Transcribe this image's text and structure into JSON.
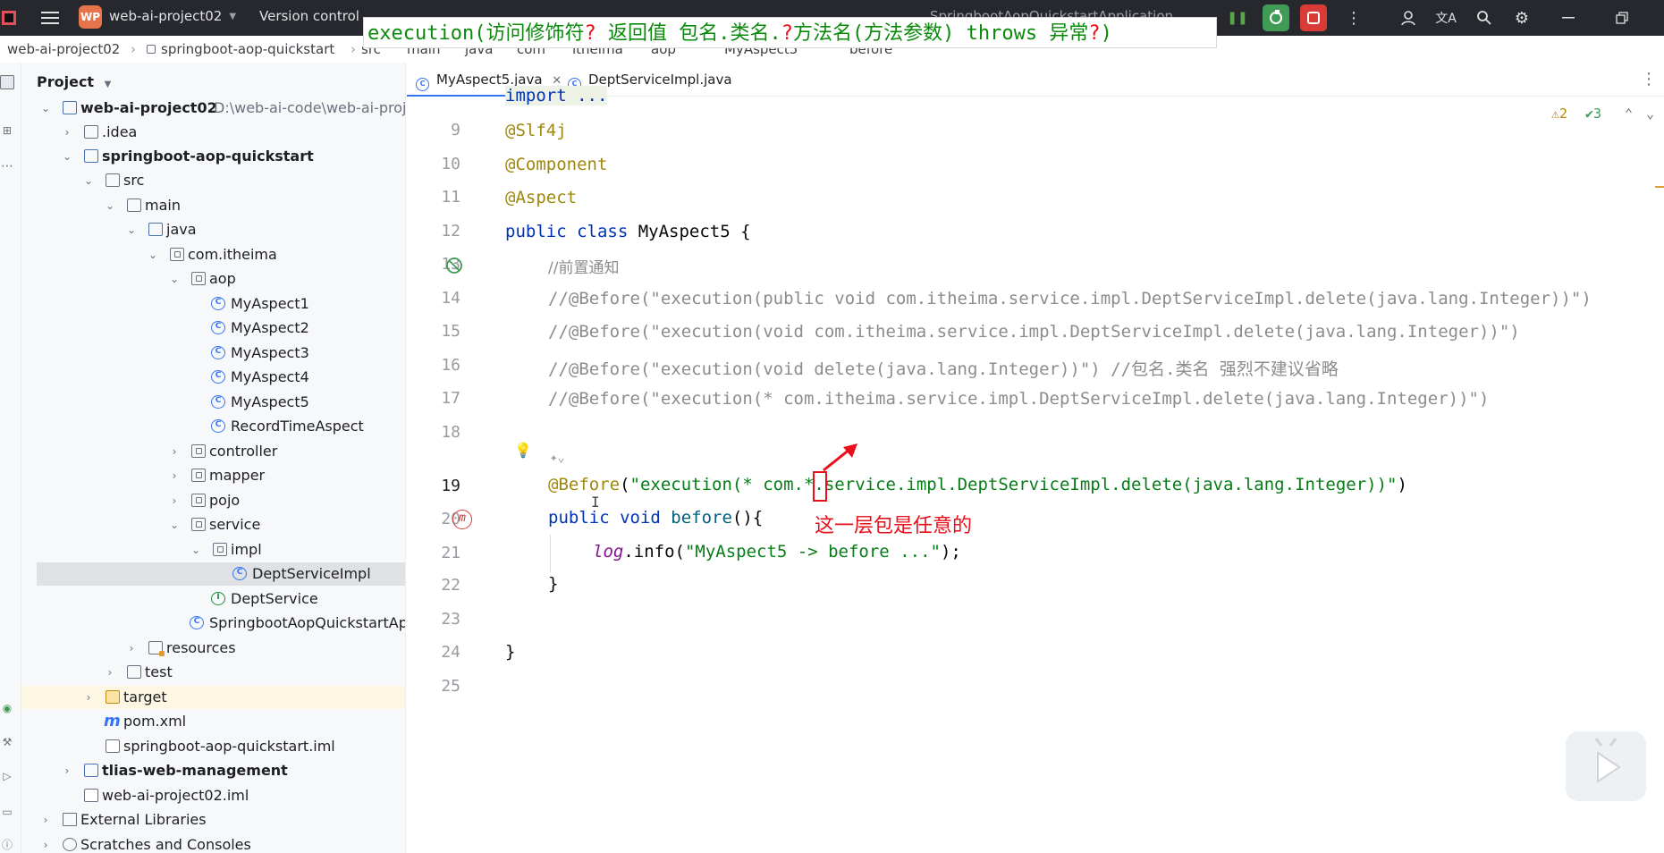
{
  "titlebar": {
    "project_badge": "WP",
    "project_name": "web-ai-project02",
    "vcs_label": "Version control",
    "run_config": "SpringbootAopQuickstartApplication"
  },
  "overlay_caption": {
    "part1": "execution(访问修饰符",
    "q1": "?",
    "part2": "  返回值  包名.类名.",
    "q2": "?",
    "part3": "方法名(方法参数) throws 异常",
    "q3": "?",
    "part4": ")"
  },
  "breadcrumb": [
    "web-ai-project02",
    "springboot-aop-quickstart",
    "src",
    "main",
    "java",
    "com",
    "itheima",
    "aop",
    "MyAspect5",
    "before"
  ],
  "project_panel": {
    "title": "Project",
    "root_path": "D:\\web-ai-code\\web-ai-proj",
    "items": [
      {
        "label": "web-ai-project02",
        "bold": true
      },
      {
        "label": ".idea"
      },
      {
        "label": "springboot-aop-quickstart",
        "bold": true
      },
      {
        "label": "src"
      },
      {
        "label": "main"
      },
      {
        "label": "java"
      },
      {
        "label": "com.itheima"
      },
      {
        "label": "aop"
      },
      {
        "label": "MyAspect1"
      },
      {
        "label": "MyAspect2"
      },
      {
        "label": "MyAspect3"
      },
      {
        "label": "MyAspect4"
      },
      {
        "label": "MyAspect5"
      },
      {
        "label": "RecordTimeAspect"
      },
      {
        "label": "controller"
      },
      {
        "label": "mapper"
      },
      {
        "label": "pojo"
      },
      {
        "label": "service"
      },
      {
        "label": "impl"
      },
      {
        "label": "DeptServiceImpl"
      },
      {
        "label": "DeptService"
      },
      {
        "label": "SpringbootAopQuickstartApp"
      },
      {
        "label": "resources"
      },
      {
        "label": "test"
      },
      {
        "label": "target"
      },
      {
        "label": "pom.xml"
      },
      {
        "label": "springboot-aop-quickstart.iml"
      },
      {
        "label": "tlias-web-management",
        "bold": true
      },
      {
        "label": "web-ai-project02.iml"
      },
      {
        "label": "External Libraries"
      },
      {
        "label": "Scratches and Consoles"
      }
    ]
  },
  "tabs": [
    {
      "label": "MyAspect5.java",
      "active": true
    },
    {
      "label": "DeptServiceImpl.java",
      "active": false
    }
  ],
  "inspections": {
    "warnings": "2",
    "ok": "3"
  },
  "editor": {
    "import_line": "import ...",
    "line_numbers": [
      "9",
      "10",
      "11",
      "12",
      "13",
      "14",
      "15",
      "16",
      "17",
      "18",
      "19",
      "20",
      "21",
      "22",
      "23",
      "24",
      "25"
    ],
    "l10": "@Slf4j",
    "l11": "@Component",
    "l12": "@Aspect",
    "l13_kw": "public class ",
    "l13_name": "MyAspect5 {",
    "l14": "//前置通知",
    "l15": "//@Before(\"execution(public void com.itheima.service.impl.DeptServiceImpl.delete(java.lang.Integer))\")",
    "l16": "//@Before(\"execution(void com.itheima.service.impl.DeptServiceImpl.delete(java.lang.Integer))\")",
    "l17": "//@Before(\"execution(void delete(java.lang.Integer))\") //包名.类名 强烈不建议省略",
    "l18": "//@Before(\"execution(* com.itheima.service.impl.DeptServiceImpl.delete(java.lang.Integer))\")",
    "l19_an": "@Before",
    "l19_p1": "(",
    "l19_str": "\"execution(* com.*.service.impl.DeptServiceImpl.delete(java.lang.Integer))\"",
    "l19_p2": ")",
    "l20_kw": "public void ",
    "l20_fn": "before",
    "l20_rest": "(){",
    "l21_log": "log",
    "l21_mid": ".info(",
    "l21_str": "\"MyAspect5 -> before ...\"",
    "l21_end": ");",
    "l22": "}",
    "l24": "}"
  },
  "annotation_note": "这一层包是任意的",
  "colors": {
    "accent": "#3574f0",
    "annotation_red": "#e8101b",
    "caption_green": "#0a8a0a"
  }
}
